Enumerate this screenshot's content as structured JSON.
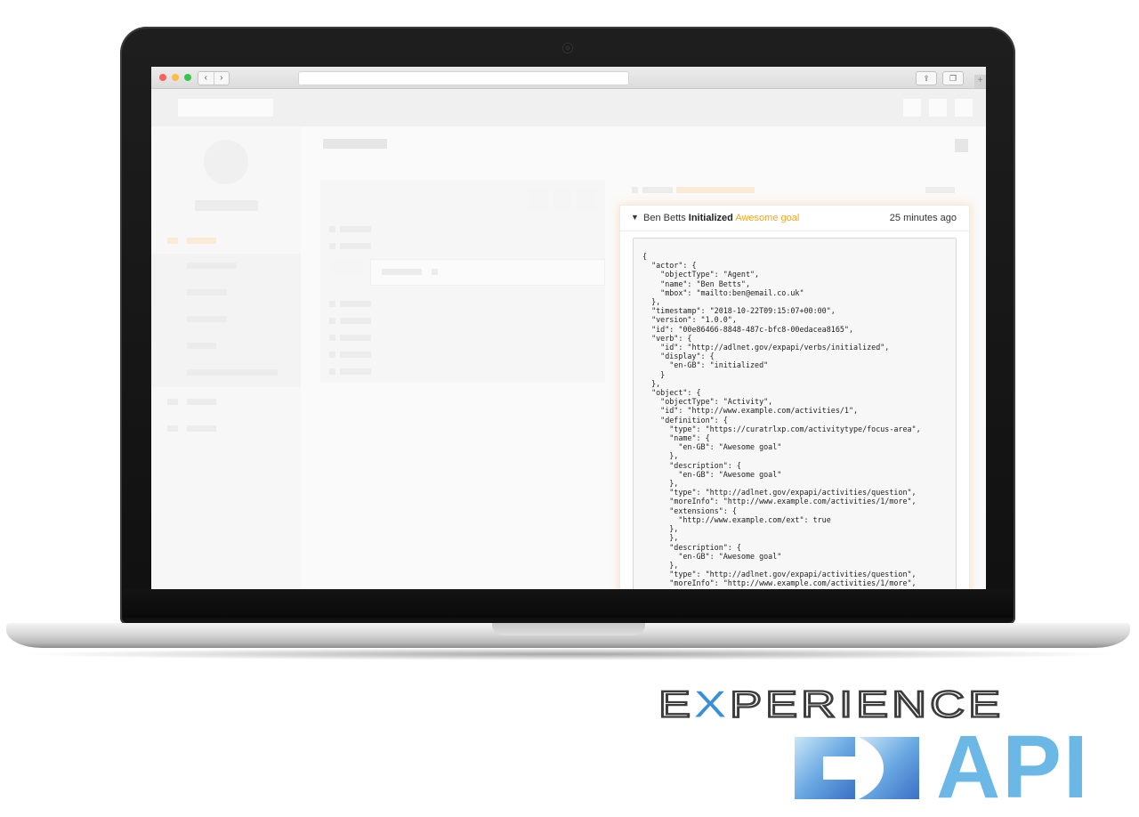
{
  "statement": {
    "actor": "Ben Betts",
    "verb": "Initialized",
    "object": "Awesome goal",
    "time": "25 minutes ago",
    "json_lines": [
      "{",
      "  \"actor\": {",
      "    \"objectType\": \"Agent\",",
      "    \"name\": \"Ben Betts\",",
      "    \"mbox\": \"mailto:ben@email.co.uk\"",
      "  },",
      "  \"timestamp\": \"2018-10-22T09:15:07+00:00\",",
      "  \"version\": \"1.0.0\",",
      "  \"id\": \"00e86466-8848-487c-bfc8-00edacea8165\",",
      "  \"verb\": {",
      "    \"id\": \"http://adlnet.gov/expapi/verbs/initialized\",",
      "    \"display\": {",
      "      \"en-GB\": \"initialized\"",
      "    }",
      "  },",
      "  \"object\": {",
      "    \"objectType\": \"Activity\",",
      "    \"id\": \"http://www.example.com/activities/1\",",
      "    \"definition\": {",
      "      \"type\": \"https://curatrlxp.com/activitytype/focus-area\",",
      "      \"name\": {",
      "        \"en-GB\": \"Awesome goal\"",
      "      },",
      "      \"description\": {",
      "        \"en-GB\": \"Awesome goal\"",
      "      },",
      "      \"type\": \"http://adlnet.gov/expapi/activities/question\",",
      "      \"moreInfo\": \"http://www.example.com/activities/1/more\",",
      "      \"extensions\": {",
      "        \"http://www.example.com/ext\": true",
      "      },",
      "      },",
      "      \"description\": {",
      "        \"en-GB\": \"Awesome goal\"",
      "      },",
      "      \"type\": \"http://adlnet.gov/expapi/activities/question\",",
      "      \"moreInfo\": \"http://www.example.com/activities/1/more\","
    ]
  },
  "logo": {
    "word": "EXPERIENCE",
    "sub": "API",
    "colors": {
      "dark": "#3c3c3c",
      "blue": "#6bb8e6",
      "accent": "#3a8fd9"
    }
  },
  "colors": {
    "object_link": "#f5a623",
    "panel_glow": "#ffaf50"
  },
  "icons": {
    "back": "‹",
    "forward": "›",
    "expand": "⌄"
  }
}
